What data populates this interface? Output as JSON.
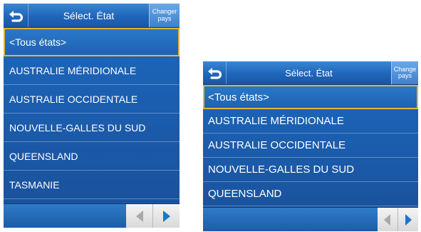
{
  "screens": [
    {
      "header": {
        "back_icon": "back-arrow-icon",
        "title": "Sélect. État",
        "change_country_line1": "Changer",
        "change_country_line2": "pays"
      },
      "items": [
        {
          "label": "<Tous états>",
          "selected": true
        },
        {
          "label": "AUSTRALIE MÉRIDIONALE"
        },
        {
          "label": "AUSTRALIE OCCIDENTALE"
        },
        {
          "label": "NOUVELLE-GALLES DU SUD"
        },
        {
          "label": "QUEENSLAND"
        },
        {
          "label": "TASMANIE"
        }
      ],
      "footer": {
        "prev_icon": "triangle-left-icon",
        "next_icon": "triangle-right-icon"
      }
    },
    {
      "header": {
        "back_icon": "back-arrow-icon",
        "title": "Sélect. État",
        "change_country_line1": "Change",
        "change_country_line2": "pays"
      },
      "items": [
        {
          "label": "<Tous états>",
          "selected": true
        },
        {
          "label": "AUSTRALIE MÉRIDIONALE"
        },
        {
          "label": "AUSTRALIE OCCIDENTALE"
        },
        {
          "label": "NOUVELLE-GALLES DU SUD"
        },
        {
          "label": "QUEENSLAND"
        }
      ],
      "footer": {
        "prev_icon": "triangle-left-icon",
        "next_icon": "triangle-right-icon"
      }
    }
  ],
  "colors": {
    "list_background": "#1b5fb1",
    "header_background": "#1f66bb",
    "selection_border": "#e3b43a",
    "arrow_left": "#aaaaaa",
    "arrow_right": "#1e74cc"
  }
}
